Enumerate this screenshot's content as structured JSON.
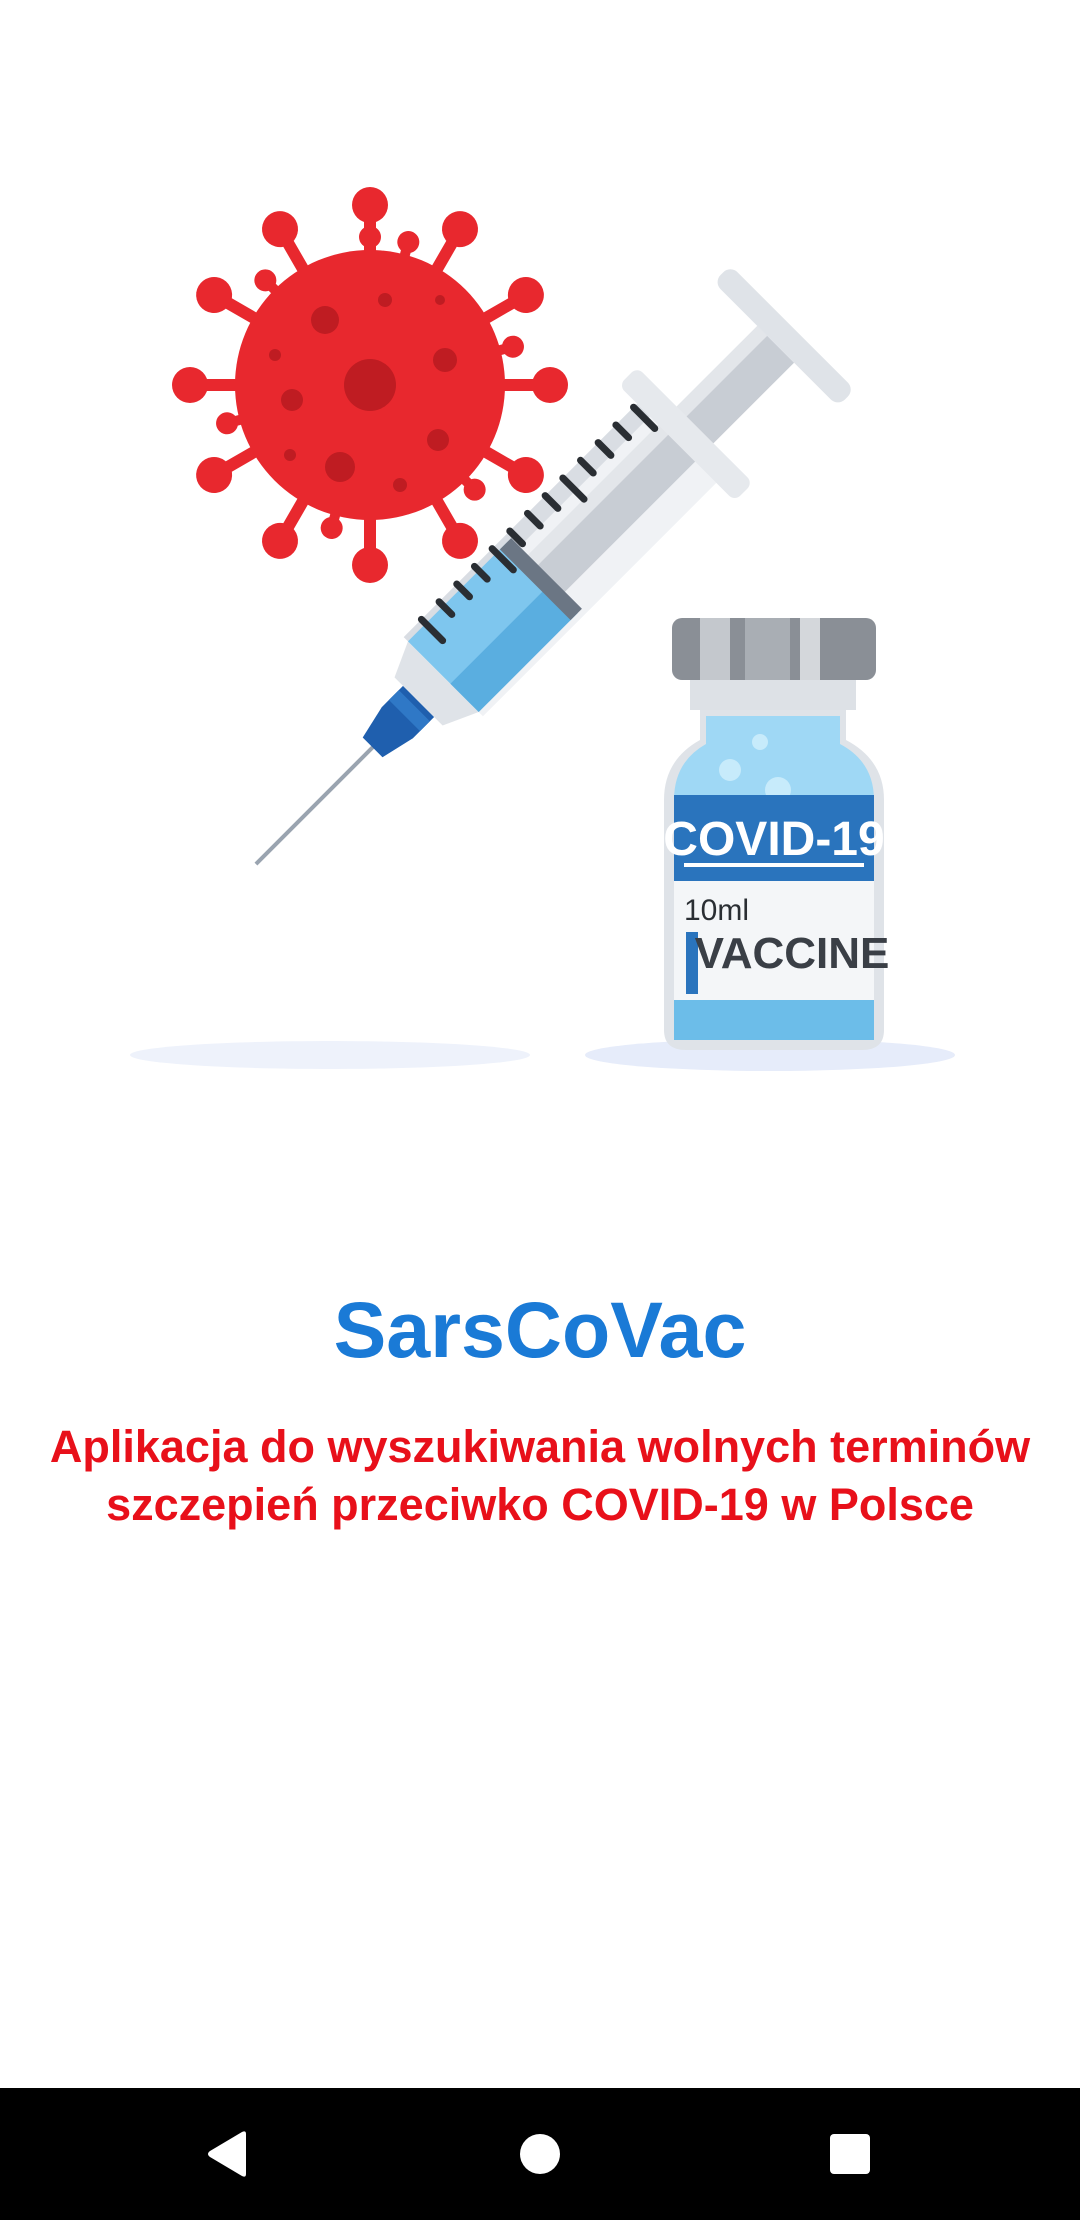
{
  "illustration": {
    "vial_label_main": "COVID-19",
    "vial_volume": "10ml",
    "vial_label_type": "VACCINE"
  },
  "splash": {
    "app_name": "SarsCoVac",
    "tagline_line1": "Aplikacja do wyszukiwania wolnych terminów",
    "tagline_line2": "szczepień przeciwko COVID-19 w Polsce"
  },
  "colors": {
    "title": "#1a7ad6",
    "tagline": "#e8101a",
    "virus": "#e8282e",
    "nav_bar": "#000000"
  },
  "navigation": {
    "icons": [
      "back-icon",
      "home-icon",
      "recents-icon"
    ]
  }
}
